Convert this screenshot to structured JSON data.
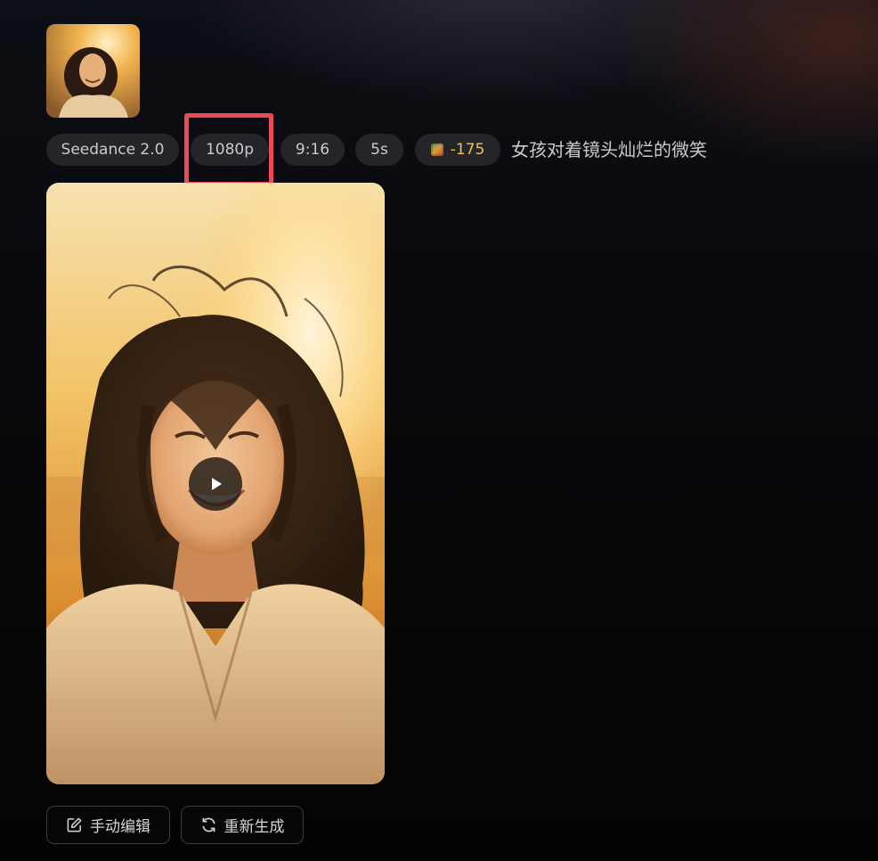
{
  "reference": {
    "thumbnail_icon": "portrait-photo-thumbnail"
  },
  "params": {
    "model": "Seedance 2.0",
    "resolution": "1080p",
    "aspect_ratio": "9:16",
    "duration": "5s",
    "cost": "-175",
    "cost_icon": "credit-coin-icon"
  },
  "prompt": "女孩对着镜头灿烂的微笑",
  "video": {
    "play_icon": "play-icon"
  },
  "actions": {
    "edit_label": "手动编辑",
    "edit_icon": "edit-icon",
    "regenerate_label": "重新生成",
    "regenerate_icon": "refresh-icon"
  },
  "colors": {
    "accent_cost": "#f2c04b",
    "highlight": "#ee4a55",
    "chip_bg": "#24252a"
  }
}
